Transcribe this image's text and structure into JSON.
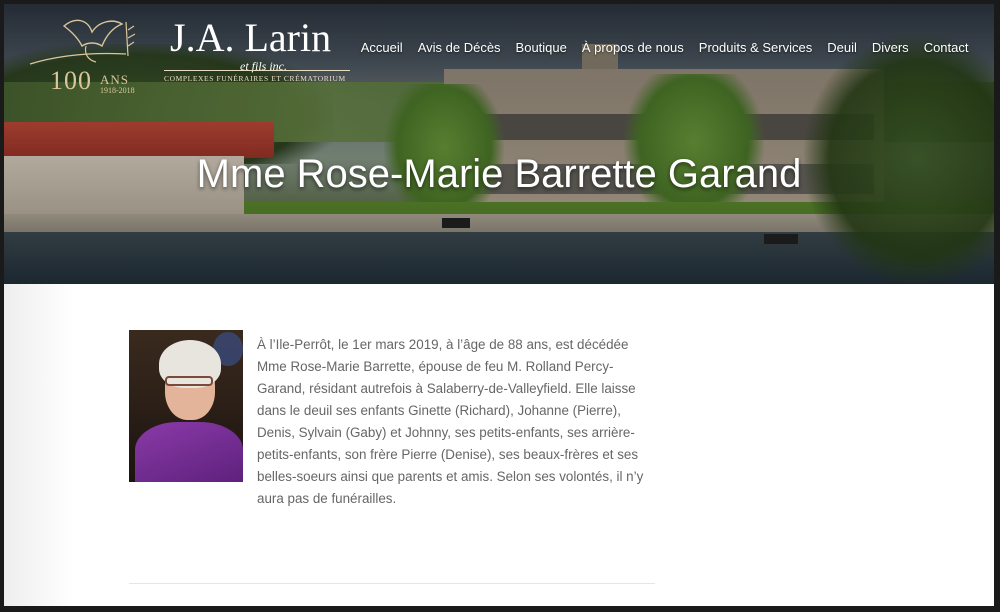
{
  "brand": {
    "name": "J.A. Larin",
    "subtitle": "et fils inc.",
    "tagline": "COMPLEXES FUNÉRAIRES ET CRÉMATORIUM",
    "anniversary_number": "100",
    "anniversary_word": "ANS",
    "anniversary_years": "1918-2018"
  },
  "nav": {
    "items": [
      {
        "label": "Accueil"
      },
      {
        "label": "Avis de Décès"
      },
      {
        "label": "Boutique"
      },
      {
        "label": "À propos de nous"
      },
      {
        "label": "Produits & Services"
      },
      {
        "label": "Deuil"
      },
      {
        "label": "Divers"
      },
      {
        "label": "Contact"
      }
    ]
  },
  "hero": {
    "title": "Mme Rose-Marie Barrette Garand"
  },
  "obituary": {
    "text": "À l’Ile-Perrôt, le 1er mars 2019, à l’âge de 88 ans, est décédée Mme Rose-Marie Barrette, épouse de feu M. Rolland Percy-Garand, résidant autrefois à Salaberry-de-Valleyfield. Elle laisse dans le deuil ses enfants Ginette (Richard), Johanne (Pierre), Denis, Sylvain (Gaby) et Johnny, ses petits-enfants, ses arrière-petits-enfants, son frère Pierre (Denise), ses beaux-frères et ses belles-soeurs ainsi que parents et amis. Selon ses volontés, il n’y aura pas de funérailles."
  },
  "colors": {
    "accent_gold": "#d9c79a",
    "body_text": "#666666",
    "background": "#ffffff"
  }
}
